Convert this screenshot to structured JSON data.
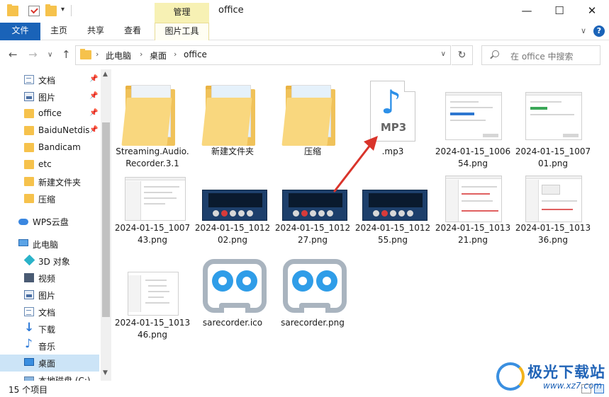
{
  "window": {
    "title": "office",
    "manage_tab": "管理",
    "minimize": "—",
    "maximize": "☐",
    "close": "✕"
  },
  "ribbon": {
    "tabs": [
      "文件",
      "主页",
      "共享",
      "查看",
      "图片工具"
    ],
    "collapse": "∨",
    "help": "?"
  },
  "navigation": {
    "back": "←",
    "forward": "→",
    "recent": "∨",
    "up": "↑",
    "breadcrumb": [
      "此电脑",
      "桌面",
      "office"
    ],
    "crumb_separator": "›",
    "address_dropdown": "∨",
    "refresh": "↻",
    "search_placeholder": "在 office 中搜索"
  },
  "sidebar": {
    "items": [
      {
        "label": "文档",
        "icon": "documents-icon",
        "pinned": true
      },
      {
        "label": "图片",
        "icon": "pictures-icon",
        "pinned": true
      },
      {
        "label": "office",
        "icon": "folder-icon",
        "pinned": true
      },
      {
        "label": "BaiduNetdis",
        "icon": "folder-icon",
        "pinned": true
      },
      {
        "label": "Bandicam",
        "icon": "folder-icon",
        "pinned": false
      },
      {
        "label": "etc",
        "icon": "folder-icon",
        "pinned": false
      },
      {
        "label": "新建文件夹",
        "icon": "folder-icon",
        "pinned": false
      },
      {
        "label": "压缩",
        "icon": "folder-icon",
        "pinned": false
      },
      {
        "label": "WPS云盘",
        "icon": "cloud-icon",
        "pinned": false
      },
      {
        "label": "此电脑",
        "icon": "computer-icon",
        "pinned": false
      },
      {
        "label": "3D 对象",
        "icon": "3d-objects-icon",
        "pinned": false
      },
      {
        "label": "视频",
        "icon": "videos-icon",
        "pinned": false
      },
      {
        "label": "图片",
        "icon": "pictures-icon",
        "pinned": false
      },
      {
        "label": "文档",
        "icon": "documents-icon",
        "pinned": false
      },
      {
        "label": "下载",
        "icon": "downloads-icon",
        "pinned": false
      },
      {
        "label": "音乐",
        "icon": "music-icon",
        "pinned": false
      },
      {
        "label": "桌面",
        "icon": "desktop-icon",
        "pinned": false,
        "selected": true
      },
      {
        "label": "本地磁盘 (C:)",
        "icon": "disk-icon",
        "pinned": false
      }
    ],
    "pin_glyph": "📌",
    "scroll_up": "▲",
    "scroll_down": "▼"
  },
  "files": [
    {
      "label": "Streaming.Audio.Recorder.3.1",
      "kind": "folder"
    },
    {
      "label": "新建文件夹",
      "kind": "folder"
    },
    {
      "label": "压缩",
      "kind": "folder"
    },
    {
      "label": ".mp3",
      "kind": "mp3",
      "badge": "MP3"
    },
    {
      "label": "2024-01-15_100654.png",
      "kind": "dialog-shot"
    },
    {
      "label": "2024-01-15_100701.png",
      "kind": "dialog-shot"
    },
    {
      "label": "2024-01-15_100743.png",
      "kind": "window-shot"
    },
    {
      "label": "2024-01-15_101202.png",
      "kind": "player-shot"
    },
    {
      "label": "2024-01-15_101227.png",
      "kind": "player-shot"
    },
    {
      "label": "2024-01-15_101255.png",
      "kind": "player-shot"
    },
    {
      "label": "2024-01-15_101321.png",
      "kind": "window-shot"
    },
    {
      "label": "2024-01-15_101336.png",
      "kind": "window-shot"
    },
    {
      "label": "2024-01-15_101346.png",
      "kind": "tree-shot"
    },
    {
      "label": "sarecorder.ico",
      "kind": "sare-icon"
    },
    {
      "label": "sarecorder.png",
      "kind": "sare-icon"
    }
  ],
  "status": {
    "count": "15 个项目"
  },
  "watermark": {
    "title": "极光下载站",
    "url": "www.xz7.com"
  },
  "colors": {
    "accent": "#1a63b8",
    "manage_tab": "#f7f1b4",
    "selection": "#cce4f7",
    "annotation": "#d9342b"
  }
}
